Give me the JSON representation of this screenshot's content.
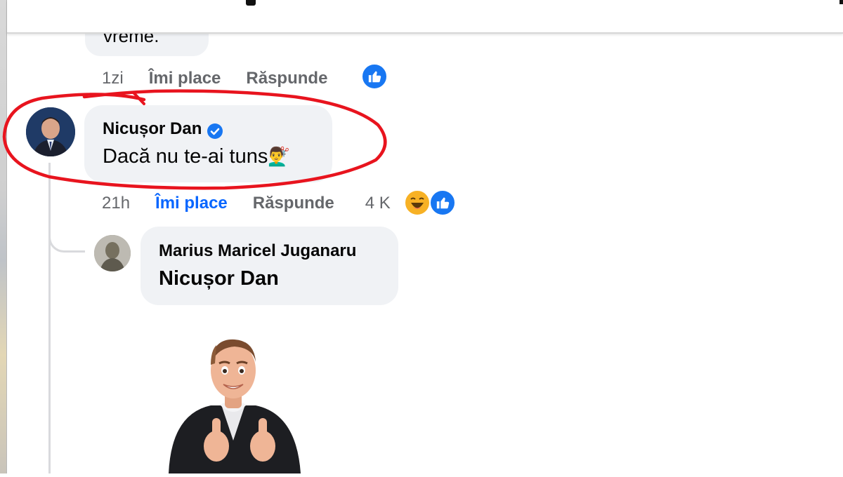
{
  "previous_comment": {
    "text_fragment": "vreme.",
    "time": "1zi",
    "like_label": "Îmi place",
    "reply_label": "Răspunde",
    "reaction_icon": "like-icon"
  },
  "comment": {
    "author": "Nicușor Dan",
    "verified": true,
    "text": "Dacă nu te-ai tuns",
    "emoji": "💇‍♂️",
    "time": "21h",
    "like_label": "Îmi place",
    "reply_label": "Răspunde",
    "reaction_count": "4 K",
    "reactions": [
      "haha-icon",
      "like-icon"
    ],
    "highlight_color": "#e8141e"
  },
  "reply": {
    "author": "Marius Maricel Juganaru",
    "mention": "Nicușor Dan",
    "sticker": "avatar-thumbs-up-sticker"
  },
  "colors": {
    "accent": "#0866ff",
    "bubble": "#f0f2f5",
    "muted_text": "#65676b"
  }
}
